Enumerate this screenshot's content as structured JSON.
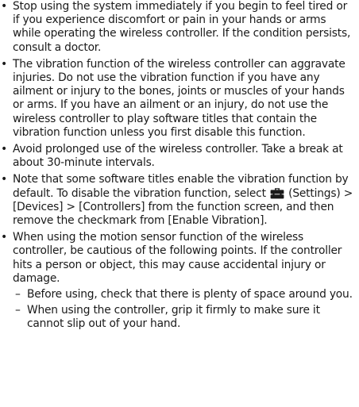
{
  "bullets": [
    {
      "text": "Stop using the system immediately if you begin to feel tired or if you experience discomfort or pain in your hands or arms while operating the wireless controller. If the condition persists, consult a doctor."
    },
    {
      "text": "The vibration function of the wireless controller can aggravate injuries. Do not use the vibration function if you have any ailment or injury to the bones, joints or muscles of your hands or arms. If you have an ailment or an injury, do not use the wireless controller to play software titles that contain the vibration function unless you first disable this function."
    },
    {
      "text": "Avoid prolonged use of the wireless controller. Take a break at about 30-minute intervals."
    },
    {
      "text_before_icon": "Note that some software titles enable the vibration function by default. To disable the vibration function, select ",
      "text_after_icon": " (Settings) > [Devices] > [Controllers] from the function screen, and then remove the checkmark from [Enable Vibration].",
      "icon": "settings-toolbox-icon"
    },
    {
      "text": "When using the motion sensor function of the wireless controller, be cautious of the following points. If the controller hits a person or object, this may cause accidental injury or damage.",
      "subitems": [
        "Before using, check that there is plenty of space around you.",
        "When using the controller, grip it firmly to make sure it cannot slip out of your hand."
      ]
    }
  ],
  "bullet_glyph": "•",
  "dash_glyph": "–",
  "colors": {
    "text": "#1a1a1a",
    "icon": "#1a1a1a",
    "background": "#ffffff"
  }
}
